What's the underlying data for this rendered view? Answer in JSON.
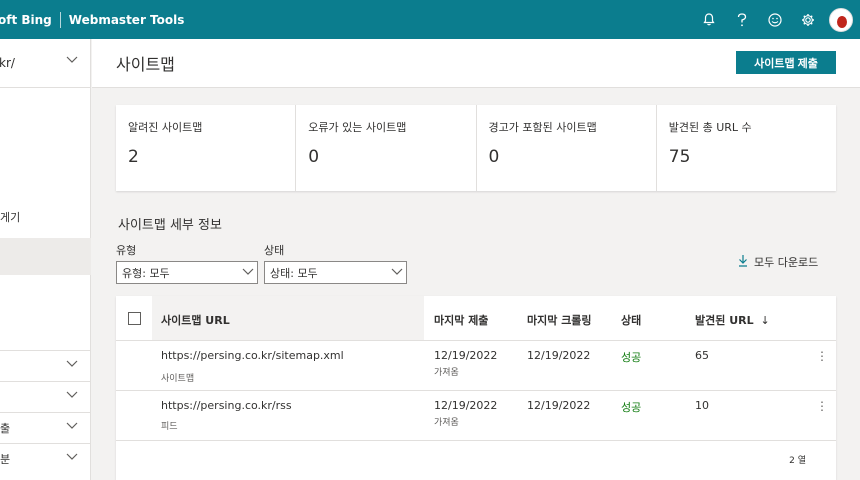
{
  "topbar": {
    "brand_left": "oft Bing",
    "brand_right": "Webmaster Tools",
    "icons": [
      "bell-icon",
      "help-icon",
      "smiley-icon",
      "gear-icon",
      "avatar"
    ]
  },
  "sidebar": {
    "site_value": "kr/",
    "partial_item": "게기",
    "groups": [
      {
        "label": ""
      },
      {
        "label": ""
      },
      {
        "label": "출"
      },
      {
        "label": "분"
      }
    ]
  },
  "header": {
    "title": "사이트맵",
    "submit_label": "사이트맵 제출"
  },
  "stats": [
    {
      "label": "알려진 사이트맵",
      "value": "2"
    },
    {
      "label": "오류가 있는 사이트맵",
      "value": "0"
    },
    {
      "label": "경고가 포함된 사이트맵",
      "value": "0"
    },
    {
      "label": "발견된 총 URL 수",
      "value": "75"
    }
  ],
  "details": {
    "title": "사이트맵 세부 정보",
    "type_label": "유형",
    "type_value": "유형: 모두",
    "status_label": "상태",
    "status_value": "상태: 모두",
    "download_label": "모두 다운로드"
  },
  "table": {
    "columns": {
      "url": "사이트맵 URL",
      "last_submit": "마지막 제출",
      "last_crawl": "마지막 크롤링",
      "status": "상태",
      "discovered": "발견된 URL",
      "sort_glyph": "↓"
    },
    "rows": [
      {
        "url": "https://persing.co.kr/sitemap.xml",
        "type": "사이트맵",
        "submitted": "12/19/2022",
        "submitted_sub": "가져옴",
        "crawled": "12/19/2022",
        "status": "성공",
        "urls": "65"
      },
      {
        "url": "https://persing.co.kr/rss",
        "type": "피드",
        "submitted": "12/19/2022",
        "submitted_sub": "가져옴",
        "crawled": "12/19/2022",
        "status": "성공",
        "urls": "10"
      }
    ],
    "row_count": "2 열"
  },
  "colors": {
    "accent": "#0b7d8e",
    "success": "#107c10"
  }
}
